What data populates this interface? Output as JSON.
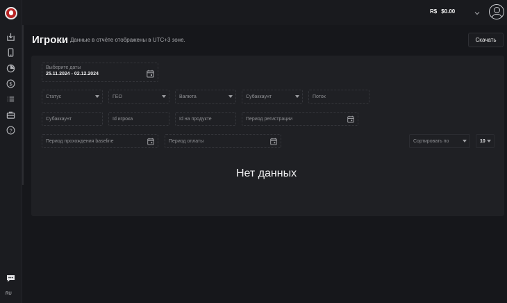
{
  "header": {
    "currency": "R$",
    "balance": "$0.00"
  },
  "sidebar": {
    "items": [
      "add-report-icon",
      "mobile-icon",
      "pie-chart-icon",
      "dollar-icon",
      "list-icon",
      "briefcase-icon",
      "help-icon"
    ],
    "lang": "RU"
  },
  "page": {
    "title": "Игроки",
    "subtitle": "Данные в отчёте отображены в UTC+3 зоне.",
    "download_label": "Скачать"
  },
  "filters": {
    "date_label": "Выберите даты",
    "date_value": "25.11.2024 - 02.12.2024",
    "status": "Статус",
    "geo": "ГЕО",
    "currency": "Валюта",
    "subaccount_select": "Субаккаунт",
    "stream": "Поток",
    "subaccount_input": "Субаккаунт",
    "player_id": "Id игрока",
    "product_id": "Id на продукте",
    "registration_period": "Период регистрации",
    "baseline_period": "Период прохождения baseline",
    "payment_period": "Период оплаты",
    "sort_by": "Сортировать по",
    "page_size": "10"
  },
  "empty_state": "Нет данных"
}
